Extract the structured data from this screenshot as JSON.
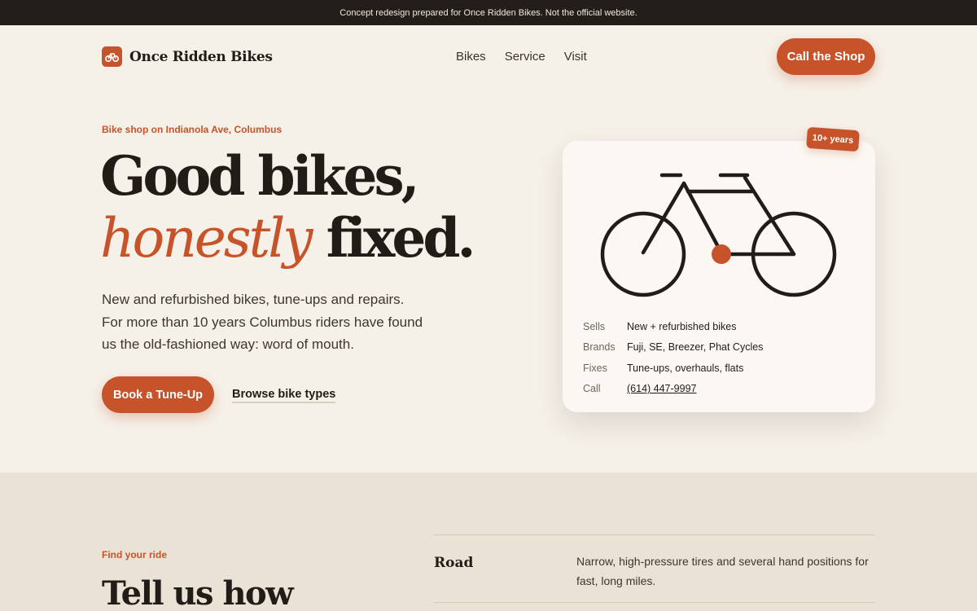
{
  "banner": {
    "text": "Concept redesign prepared for Once Ridden Bikes. Not the official website."
  },
  "header": {
    "logo_icon": "bicycle-icon",
    "brand": "Once Ridden Bikes",
    "nav": [
      {
        "label": "Bikes"
      },
      {
        "label": "Service"
      },
      {
        "label": "Visit"
      }
    ],
    "cta": "Call the Shop"
  },
  "hero": {
    "eyebrow": "Bike shop on Indianola Ave, Columbus",
    "headline_line1": "Good bikes,",
    "headline_accent": "honestly",
    "headline_end": "fixed.",
    "lede": "New and refurbished bikes, tune-ups and repairs. For more than 10 years Columbus riders have found us the old-fashioned way: word of mouth.",
    "primary_button": "Book a Tune-Up",
    "secondary_link": "Browse bike types"
  },
  "card": {
    "badge": "10+ years",
    "illustration": "bicycle-illustration",
    "specs": [
      {
        "key": "Sells",
        "value": "New + refurbished bikes"
      },
      {
        "key": "Brands",
        "value": "Fuji, SE, Breezer, Phat Cycles"
      },
      {
        "key": "Fixes",
        "value": "Tune-ups, overhauls, flats"
      },
      {
        "key": "Call",
        "value": "(614) 447-9997"
      }
    ]
  },
  "find": {
    "eyebrow": "Find your ride",
    "heading": "Tell us how",
    "types": [
      {
        "name": "Road",
        "description": "Narrow, high-pressure tires and several hand positions for fast, long miles."
      }
    ]
  },
  "colors": {
    "accent": "#c6532a",
    "ink": "#211c17",
    "background": "#f5f0e8",
    "section_bg": "#ebe2d6"
  }
}
